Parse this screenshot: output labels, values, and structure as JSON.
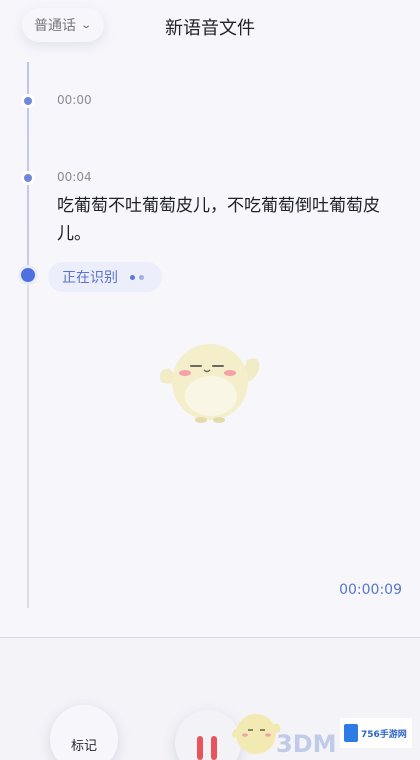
{
  "header": {
    "language_label": "普通话",
    "title": "新语音文件"
  },
  "timeline": {
    "entries": [
      {
        "timestamp": "00:00",
        "text": ""
      },
      {
        "timestamp": "00:04",
        "text": "吃葡萄不吐葡萄皮儿，不吃葡萄倒吐葡萄皮儿。"
      }
    ],
    "status_label": "正在识别"
  },
  "elapsed_time": "00:00:09",
  "controls": {
    "mark_label": "标记"
  },
  "watermark": {
    "text": "3DM",
    "badge_text": "756手游网"
  },
  "colors": {
    "accent": "#4d6fe0",
    "pause": "#e7545b",
    "background": "#f6f6fb"
  },
  "icons": [
    "chevron-down-icon",
    "pause-icon",
    "mascot-illustration"
  ]
}
